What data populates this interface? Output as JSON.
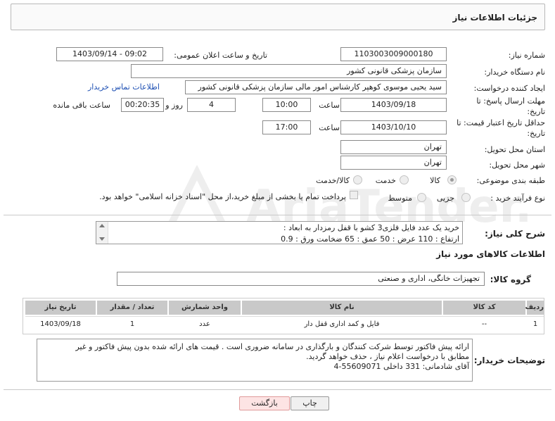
{
  "header": {
    "title": "جزئیات اطلاعات نیاز"
  },
  "form": {
    "need_number_label": "شماره نیاز:",
    "need_number": "1103003009000180",
    "announce_label": "تاریخ و ساعت اعلان عمومی:",
    "announce_value": "1403/09/14 - 09:02",
    "buyer_org_label": "نام دستگاه خریدار:",
    "buyer_org": "سازمان پزشکی قانونی کشور",
    "creator_label": "ایجاد کننده درخواست:",
    "creator": "سید یحیی موسوی کوهپر کارشناس امور مالی سازمان پزشکی قانونی کشور",
    "buyer_contact_link": "اطلاعات تماس خریدار",
    "deadline_label_1": "مهلت ارسال پاسخ: تا",
    "deadline_label_2": "تاریخ:",
    "deadline_date": "1403/09/18",
    "time_label": "ساعت",
    "deadline_time": "10:00",
    "days_value": "4",
    "days_label": "روز و",
    "remaining_time": "00:20:35",
    "remaining_label": "ساعت باقی مانده",
    "validity_label_1": "حداقل تاریخ اعتبار قیمت: تا",
    "validity_label_2": "تاریخ:",
    "validity_date": "1403/10/10",
    "validity_time": "17:00",
    "province_label": "استان محل تحویل:",
    "province": "تهران",
    "city_label": "شهر محل تحویل:",
    "city": "تهران",
    "category_label": "طبقه بندی موضوعی:",
    "category_options": [
      "کالا",
      "خدمت",
      "کالا/خدمت"
    ],
    "category_selected": "کالا",
    "process_label": "نوع فرآیند خرید :",
    "process_options": [
      "جزیی",
      "متوسط"
    ],
    "payment_note": "پرداخت تمام یا بخشی از مبلغ خرید،از محل \"اسناد خزانه اسلامی\" خواهد بود."
  },
  "description": {
    "label": "شرح کلی نیاز:",
    "line1": "خرید یک عدد فایل فلزی3 کشو با قفل رمزدار به ابعاد :",
    "line2": "ارتفاع :  110   عرض : 50  عمق : 65  ضخامت ورق : 0.9"
  },
  "goods": {
    "section_title": "اطلاعات کالاهای مورد نیاز",
    "group_label": "گروه کالا:",
    "group_value": "تجهیزات خانگی، اداری و صنعتی",
    "columns": [
      "ردیف",
      "کد کالا",
      "نام کالا",
      "واحد شمارش",
      "تعداد / مقدار",
      "تاریخ نیاز"
    ],
    "rows": [
      {
        "index": "1",
        "code": "--",
        "name": "فایل و کمد اداری قفل دار",
        "unit": "عدد",
        "qty": "1",
        "date": "1403/09/18"
      }
    ]
  },
  "buyer_notes": {
    "label": "توضیحات خریدار:",
    "line1": "ارائه پیش فاکتور  توسط شرکت کنندگان و بارگذاری در سامانه ضروری است . قیمت های ارائه شده بدون پیش فاکتور  و غیر",
    "line2": "مطابق با درخواست اعلام نیاز  ، حذف خواهد گردید.",
    "line3": "آقای شادمانی:   331   داخلی        55609071-4"
  },
  "watermark": {
    "text": "AriaTender.neT"
  },
  "buttons": {
    "print": "چاپ",
    "back": "بازگشت"
  },
  "colors": {
    "back_button_bg": "#fde4e4",
    "back_button_border": "#e09a9a",
    "link": "#1d4fb3",
    "header_border": "#b8b8b8"
  }
}
